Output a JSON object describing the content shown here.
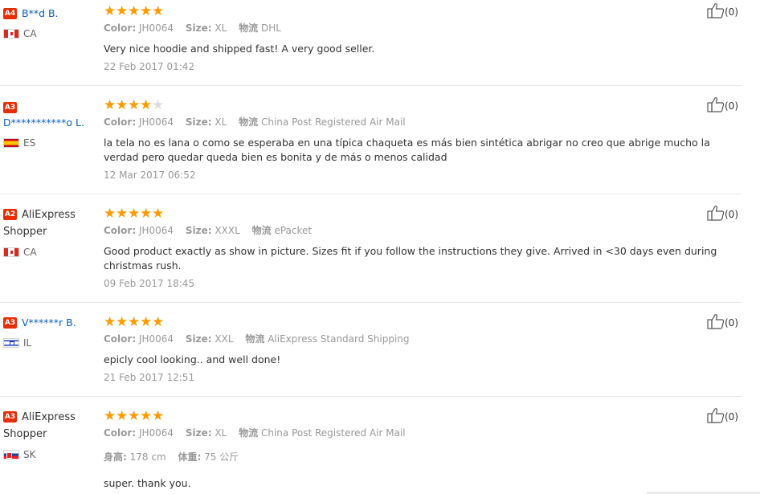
{
  "labels": {
    "color": "Color:",
    "size": "Size:",
    "logistics": "物流",
    "height": "身高:",
    "weight": "体重:"
  },
  "reviews": [
    {
      "badge": "A4",
      "name": "B**d B.",
      "country": "CA",
      "stars": 5,
      "color_value": "JH0064",
      "size_value": "XL",
      "logistics_value": "DHL",
      "text": "Very nice hoodie and shipped fast! A very good seller.",
      "date": "22 Feb 2017 01:42",
      "helpful": "(0)"
    },
    {
      "badge": "A3",
      "name": "D***********o L.",
      "country": "ES",
      "stars": 4,
      "color_value": "JH0064",
      "size_value": "XL",
      "logistics_value": "China Post Registered Air Mail",
      "text": "la tela no es lana o como se esperaba en una típica chaqueta es más bien sintética abrigar no creo que abrige mucho la verdad pero quedar queda bien es bonita y de más o menos calidad",
      "date": "12 Mar 2017 06:52",
      "helpful": "(0)"
    },
    {
      "badge": "A2",
      "name": "AliExpress Shopper",
      "country": "CA",
      "stars": 5,
      "color_value": "JH0064",
      "size_value": "XXXL",
      "logistics_value": "ePacket",
      "text": "Good product exactly as show in picture. Sizes fit if you follow the instructions they give. Arrived in <30 days even during christmas rush.",
      "date": "09 Feb 2017 18:45",
      "helpful": "(0)"
    },
    {
      "badge": "A3",
      "name": "V******r B.",
      "country": "IL",
      "stars": 5,
      "color_value": "JH0064",
      "size_value": "XXL",
      "logistics_value": "AliExpress Standard Shipping",
      "text": "epicly cool looking.. and well done!",
      "date": "21 Feb 2017 12:51",
      "helpful": "(0)"
    },
    {
      "badge": "A3",
      "name": "AliExpress Shopper",
      "country": "SK",
      "stars": 5,
      "color_value": "JH0064",
      "size_value": "XL",
      "logistics_value": "China Post Registered Air Mail",
      "height_value": "178 cm",
      "weight_value": "75 公斤",
      "text": "super. thank you.",
      "helpful": "(0)"
    }
  ],
  "colors": {
    "star": "#ff9a00",
    "badge": "#e62e04",
    "link": "#0a5fc2"
  }
}
